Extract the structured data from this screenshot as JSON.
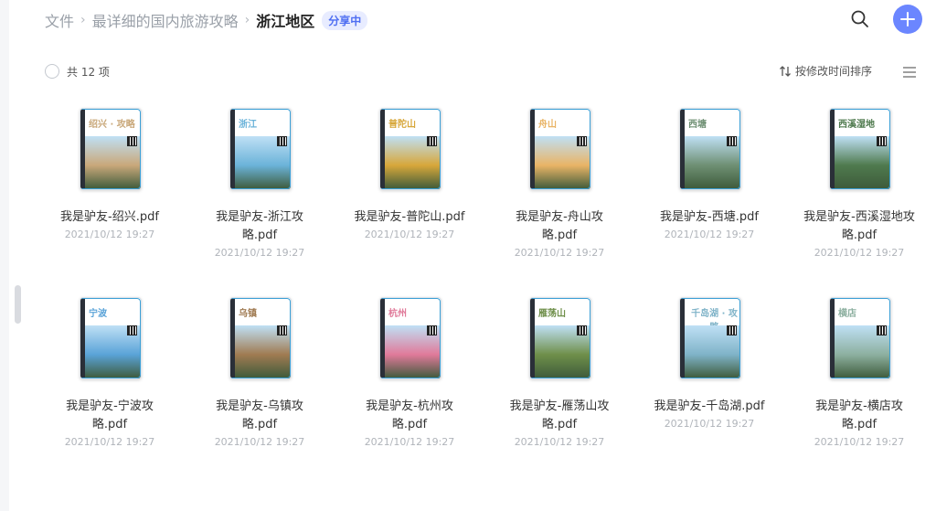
{
  "breadcrumb": {
    "root": "文件",
    "parent": "最详细的国内旅游攻略",
    "current": "浙江地区",
    "badge": "分享中"
  },
  "toolbar": {
    "count_label": "共 12 项",
    "sort_label": "按修改时间排序"
  },
  "icons": {
    "search": "search-icon",
    "add": "plus-icon",
    "sort": "sort-arrows-icon",
    "view": "list-view-icon"
  },
  "colors": {
    "accent": "#6b86ff",
    "badge_text": "#4e6ef2",
    "badge_bg": "#e8ecff"
  },
  "files": [
    {
      "name": "我是驴友-绍兴.pdf",
      "date": "2021/10/12 19:27",
      "cover_title": "绍兴 · 攻略",
      "cover_color": "#c9a87a"
    },
    {
      "name": "我是驴友-浙江攻略.pdf",
      "date": "2021/10/12 19:27",
      "cover_title": "浙江",
      "cover_color": "#6bb3d9"
    },
    {
      "name": "我是驴友-普陀山.pdf",
      "date": "2021/10/12 19:27",
      "cover_title": "普陀山",
      "cover_color": "#d7a73a"
    },
    {
      "name": "我是驴友-舟山攻略.pdf",
      "date": "2021/10/12 19:27",
      "cover_title": "舟山",
      "cover_color": "#e9b466"
    },
    {
      "name": "我是驴友-西塘.pdf",
      "date": "2021/10/12 19:27",
      "cover_title": "西塘",
      "cover_color": "#6e8f73"
    },
    {
      "name": "我是驴友-西溪湿地攻略.pdf",
      "date": "2021/10/12 19:27",
      "cover_title": "西溪湿地",
      "cover_color": "#4f7a4e"
    },
    {
      "name": "我是驴友-宁波攻略.pdf",
      "date": "2021/10/12 19:27",
      "cover_title": "宁波",
      "cover_color": "#5aa3d8"
    },
    {
      "name": "我是驴友-乌镇攻略.pdf",
      "date": "2021/10/12 19:27",
      "cover_title": "乌镇",
      "cover_color": "#a07b52"
    },
    {
      "name": "我是驴友-杭州攻略.pdf",
      "date": "2021/10/12 19:27",
      "cover_title": "杭州",
      "cover_color": "#e07a9a"
    },
    {
      "name": "我是驴友-雁荡山攻略.pdf",
      "date": "2021/10/12 19:27",
      "cover_title": "雁荡山",
      "cover_color": "#6f8f4a"
    },
    {
      "name": "我是驴友-千岛湖.pdf",
      "date": "2021/10/12 19:27",
      "cover_title": "千岛湖 · 攻略",
      "cover_color": "#7fb3c8"
    },
    {
      "name": "我是驴友-横店攻略.pdf",
      "date": "2021/10/12 19:27",
      "cover_title": "横店",
      "cover_color": "#8db0a0"
    }
  ]
}
